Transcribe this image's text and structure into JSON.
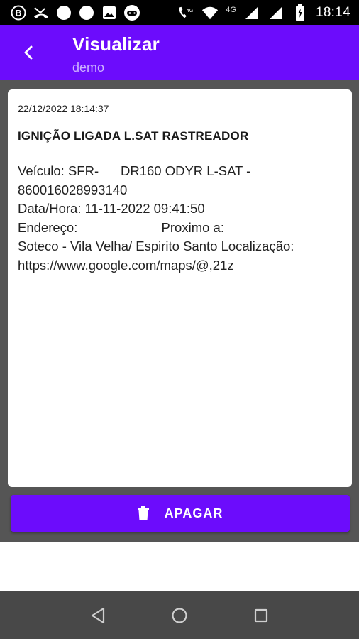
{
  "status_bar": {
    "time": "18:14",
    "network_label": "4G",
    "icons": [
      "b-circle-icon",
      "missed-call-icon",
      "dot-icon",
      "dot-icon",
      "image-icon",
      "game-icon",
      "wifi-call-icon",
      "wifi-icon",
      "signal-icon",
      "signal-icon",
      "battery-charging-icon"
    ]
  },
  "app_bar": {
    "title": "Visualizar",
    "subtitle": "demo",
    "color": "#6c0cfc"
  },
  "message": {
    "date": "22/12/2022 18:14:37",
    "title": "IGNIÇÃO LIGADA L.SAT RASTREADOR",
    "body": "Veículo: SFR-      DR160 ODYR L-SAT -\n860016028993140\nData/Hora: 11-11-2022 09:41:50\nEndereço:                       Proximo a:\nSoteco - Vila Velha/ Espirito Santo Localização:\nhttps://www.google.com/maps/@,21z"
  },
  "actions": {
    "delete_label": "APAGAR",
    "delete_icon": "trash-icon"
  },
  "nav_bar": {
    "icons": [
      "back-triangle-icon",
      "home-circle-icon",
      "recents-square-icon"
    ]
  }
}
